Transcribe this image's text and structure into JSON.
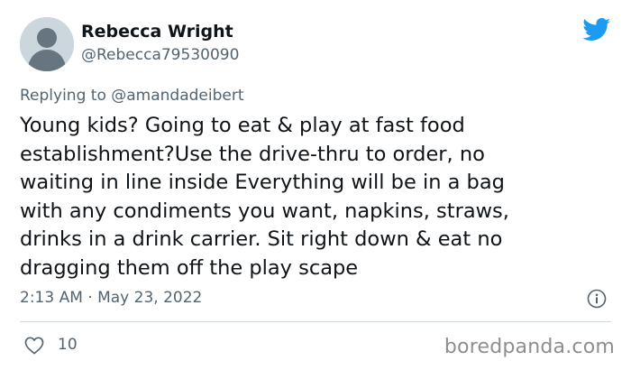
{
  "author": {
    "display_name": "Rebecca Wright",
    "handle": "@Rebecca79530090"
  },
  "reply": {
    "prefix": "Replying to",
    "to_handle": "@amandadeibert"
  },
  "tweet": {
    "lines": [
      "Young kids? Going to eat & play at fast food",
      "establishment?Use the drive-thru to order, no",
      "waiting in line inside Everything will be in a bag",
      "with any condiments you want, napkins, straws,",
      "drinks in a drink carrier. Sit right down & eat no",
      "dragging them off the play scape"
    ],
    "timestamp": "2:13 AM · May 23, 2022"
  },
  "engagement": {
    "likes": "10"
  },
  "watermark": "boredpanda.com",
  "icons": {
    "brand": "twitter-bird-icon",
    "info": "info-icon",
    "like": "heart-icon",
    "avatar": "default-avatar-icon"
  },
  "colors": {
    "twitter_blue": "#1d9bf0",
    "secondary_text": "#536471",
    "primary_text": "#0f1419",
    "divider": "#cfd9de",
    "avatar_bg": "#ccd6dd"
  }
}
